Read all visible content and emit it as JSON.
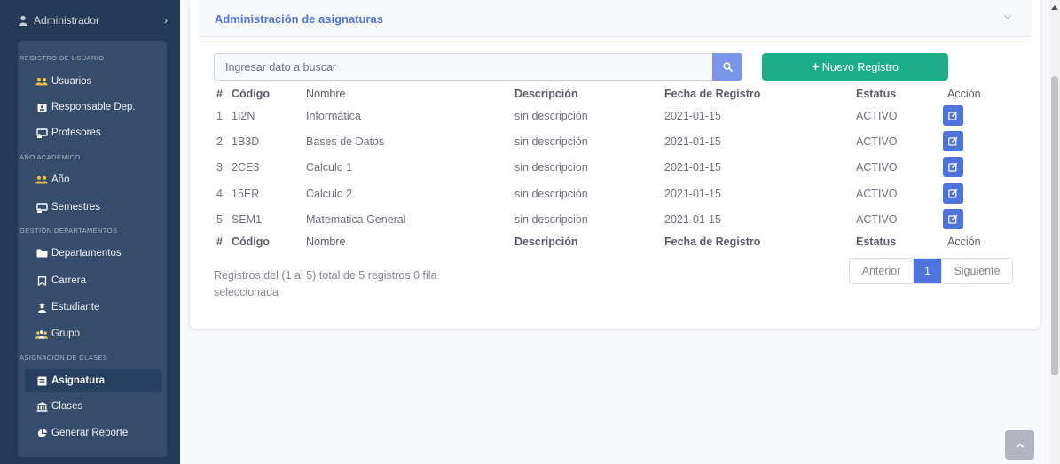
{
  "sidebar": {
    "user_label": "Administrador",
    "sections": {
      "registro": "REGISTRO DE USUARIO",
      "anio": "AÑO ACADEMICO",
      "gestion": "GESTIÓN DEPARTAMENTOS",
      "asignacion": "ASIGNACIÓN DE CLASES"
    },
    "items": [
      {
        "label": "Usuarios",
        "icon": "users-icon"
      },
      {
        "label": "Responsable Dep.",
        "icon": "id-badge-icon"
      },
      {
        "label": "Profesores",
        "icon": "chalkboard-teacher-icon"
      },
      {
        "label": "Año",
        "icon": "users-icon"
      },
      {
        "label": "Semestres",
        "icon": "chalkboard-icon"
      },
      {
        "label": "Departamentos",
        "icon": "folder-icon"
      },
      {
        "label": "Carrera",
        "icon": "bookmark-icon"
      },
      {
        "label": "Estudiante",
        "icon": "user-graduate-icon"
      },
      {
        "label": "Grupo",
        "icon": "group-icon"
      },
      {
        "label": "Asignatura",
        "icon": "book-icon",
        "active": true
      },
      {
        "label": "Clases",
        "icon": "university-icon"
      },
      {
        "label": "Generar Reporte",
        "icon": "chart-pie-icon"
      }
    ]
  },
  "card": {
    "title": "Administración de asignaturas"
  },
  "search": {
    "placeholder": "Ingresar dato a buscar"
  },
  "new_button": {
    "label": "Nuevo Registro"
  },
  "table": {
    "columns": [
      "#",
      "Código",
      "Nombre",
      "Descripción",
      "Fecha de Registro",
      "Estatus",
      "Acción"
    ],
    "rows": [
      {
        "n": "1",
        "codigo": "1I2N",
        "nombre": "Informática",
        "descripcion": "sin descripción",
        "fecha": "2021-01-15",
        "estatus": "ACTIVO"
      },
      {
        "n": "2",
        "codigo": "1B3D",
        "nombre": "Bases de Datos",
        "descripcion": "sin descripción",
        "fecha": "2021-01-15",
        "estatus": "ACTIVO"
      },
      {
        "n": "3",
        "codigo": "2CE3",
        "nombre": "Calculo 1",
        "descripcion": "sin descripcion",
        "fecha": "2021-01-15",
        "estatus": "ACTIVO"
      },
      {
        "n": "4",
        "codigo": "15ER",
        "nombre": "Calculo 2",
        "descripcion": "sin descripción",
        "fecha": "2021-01-15",
        "estatus": "ACTIVO"
      },
      {
        "n": "5",
        "codigo": "SEM1",
        "nombre": "Matematica General",
        "descripcion": "sin descripcion",
        "fecha": "2021-01-15",
        "estatus": "ACTIVO"
      }
    ]
  },
  "info": {
    "text": "Registros del (1 al 5) total de 5 registros    0 fila seleccionada"
  },
  "pagination": {
    "prev": "Anterior",
    "current": "1",
    "next": "Siguiente"
  },
  "colors": {
    "sidebar": "#243a56",
    "primary": "#4e73df",
    "success": "#1cae89"
  }
}
